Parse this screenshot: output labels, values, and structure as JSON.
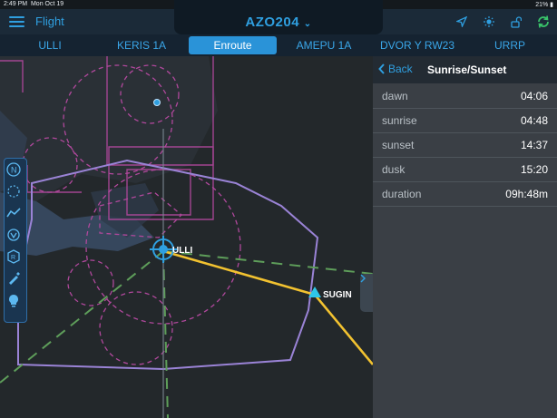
{
  "status": {
    "time": "2:49 PM",
    "date": "Mon Oct 19",
    "battery": "21%"
  },
  "header": {
    "flight_label": "Flight",
    "flight_title": "AZO204"
  },
  "tabs": [
    {
      "label": "ULLI",
      "active": false
    },
    {
      "label": "KERIS 1A",
      "active": false
    },
    {
      "label": "Enroute",
      "active": true
    },
    {
      "label": "AMEPU 1A",
      "active": false
    },
    {
      "label": "DVOR Y RW23",
      "active": false
    },
    {
      "label": "URRP",
      "active": false
    }
  ],
  "map": {
    "airport_label": "ULLI",
    "waypoint_label": "SUGIN",
    "colors": {
      "route": "#f2c230",
      "airspace": "#9a83d6",
      "restricted": "#b0489c",
      "accent": "#2f9fe0"
    }
  },
  "toolbar_tools": [
    "north-up-icon",
    "range-ring-icon",
    "route-icon",
    "vor-icon",
    "restricted-icon",
    "pencil-icon",
    "bulb-icon"
  ],
  "panel": {
    "back_label": "Back",
    "title": "Sunrise/Sunset",
    "rows": [
      {
        "label": "dawn",
        "value": "04:06"
      },
      {
        "label": "sunrise",
        "value": "04:48"
      },
      {
        "label": "sunset",
        "value": "14:37"
      },
      {
        "label": "dusk",
        "value": "15:20"
      },
      {
        "label": "duration",
        "value": "09h:48m"
      }
    ]
  }
}
